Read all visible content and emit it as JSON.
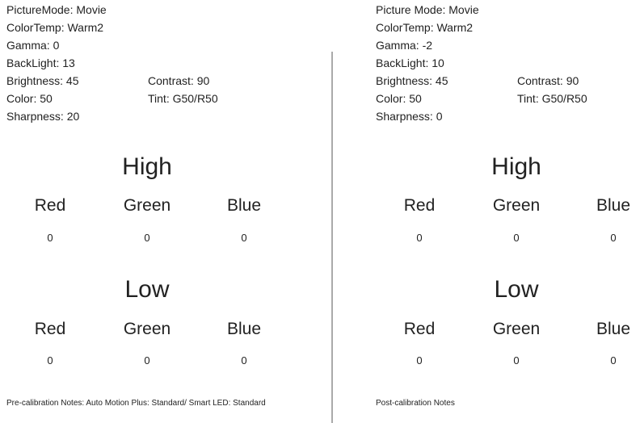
{
  "panels": [
    {
      "picture_mode": "PictureMode: Movie",
      "color_temp": "ColorTemp: Warm2",
      "gamma": "Gamma: 0",
      "backlight": "BackLight: 13",
      "brightness": "Brightness: 45",
      "contrast": "Contrast: 90",
      "color": "Color: 50",
      "tint": "Tint: G50/R50",
      "sharpness": "Sharpness: 20",
      "high": {
        "title": "High",
        "labels": [
          "Red",
          "Green",
          "Blue"
        ],
        "values": [
          "0",
          "0",
          "0"
        ]
      },
      "low": {
        "title": "Low",
        "labels": [
          "Red",
          "Green",
          "Blue"
        ],
        "values": [
          "0",
          "0",
          "0"
        ]
      },
      "notes": "Pre-calibration Notes: Auto Motion Plus: Standard/ Smart LED: Standard"
    },
    {
      "picture_mode": "Picture Mode: Movie",
      "color_temp": "ColorTemp: Warm2",
      "gamma": "Gamma: -2",
      "backlight": "BackLight: 10",
      "brightness": "Brightness: 45",
      "contrast": "Contrast: 90",
      "color": "Color: 50",
      "tint": "Tint: G50/R50",
      "sharpness": "Sharpness: 0",
      "high": {
        "title": "High",
        "labels": [
          "Red",
          "Green",
          "Blue"
        ],
        "values": [
          "0",
          "0",
          "0"
        ]
      },
      "low": {
        "title": "Low",
        "labels": [
          "Red",
          "Green",
          "Blue"
        ],
        "values": [
          "0",
          "0",
          "0"
        ]
      },
      "notes": "Post-calibration Notes"
    }
  ]
}
